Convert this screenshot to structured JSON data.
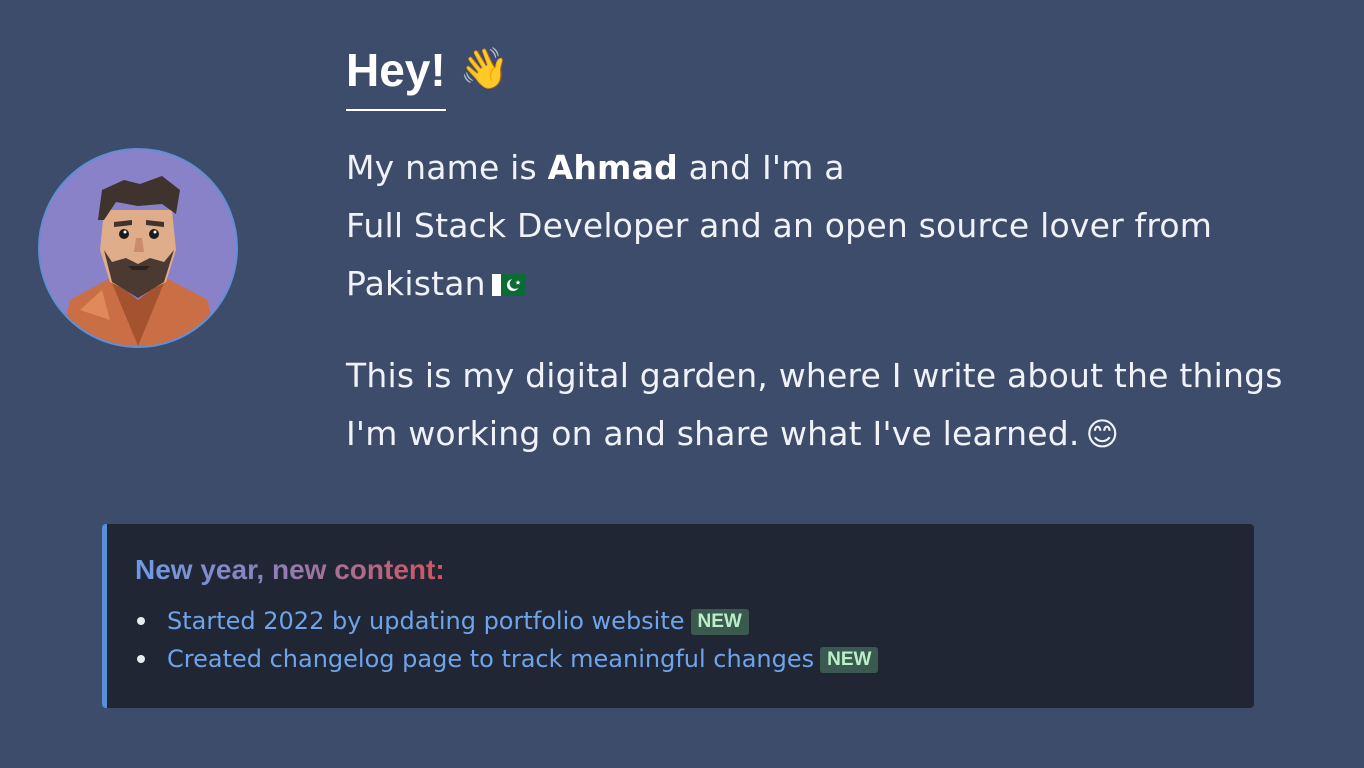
{
  "intro": {
    "heading": "Hey!",
    "wave_emoji": "👋",
    "line1_prefix": "My name is ",
    "name": "Ahmad",
    "line1_suffix": " and I'm a",
    "line2": "Full Stack Developer and an open source lover from Pakistan",
    "paragraph2": "This is my digital garden, where I write about the things I'm working on and share what I've learned.",
    "smile_emoji": "😊"
  },
  "avatar": {
    "icon": "avatar-portrait",
    "background": "#8a82c8"
  },
  "callout": {
    "title": "New year, new content:",
    "items": [
      {
        "text": "Started 2022 by updating portfolio website",
        "badge": "NEW"
      },
      {
        "text": "Created changelog page to track meaningful changes",
        "badge": "NEW"
      }
    ]
  },
  "colors": {
    "background": "#3d4c6b",
    "callout_bg": "#212634",
    "callout_border": "#5a8fd8",
    "link": "#6ea4ea",
    "badge_bg": "#3a5a4f",
    "badge_text": "#b9f0c8"
  }
}
